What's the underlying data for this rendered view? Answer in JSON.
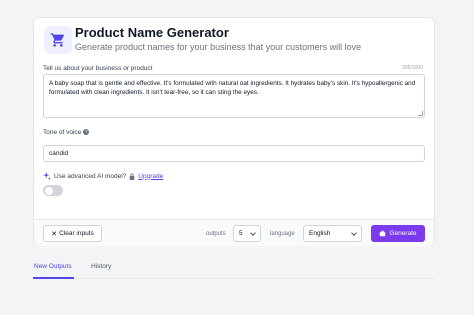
{
  "app": {
    "title": "Product Name Generator",
    "subtitle": "Generate product names for your business that your customers will love",
    "icon": "shopping-cart-icon",
    "accent_color": "#4f46e5",
    "generate_color": "#7c3aed"
  },
  "form": {
    "about_label": "Tell us about your business or product",
    "about_counter": "305/1000",
    "about_value": "A baby soap that is gentle and effective. It's formulated with natural oat ingredients. It hydrates baby's skin. It's hypoallergenic and formulated with clean ingredients. It isn't tear-free, so it can sting the eyes.",
    "tone_label": "Tone of voice",
    "tone_value": "candid",
    "advanced_label": "Use advanced AI model?",
    "advanced_link": "Upgrade",
    "advanced_enabled": false
  },
  "footer": {
    "clear_label": "Clear inputs",
    "outputs_label": "outputs",
    "outputs_value": "5",
    "language_label": "language",
    "language_value": "English",
    "generate_label": "Generate"
  },
  "tabs": [
    {
      "label": "New Outputs",
      "active": true
    },
    {
      "label": "History",
      "active": false
    }
  ]
}
